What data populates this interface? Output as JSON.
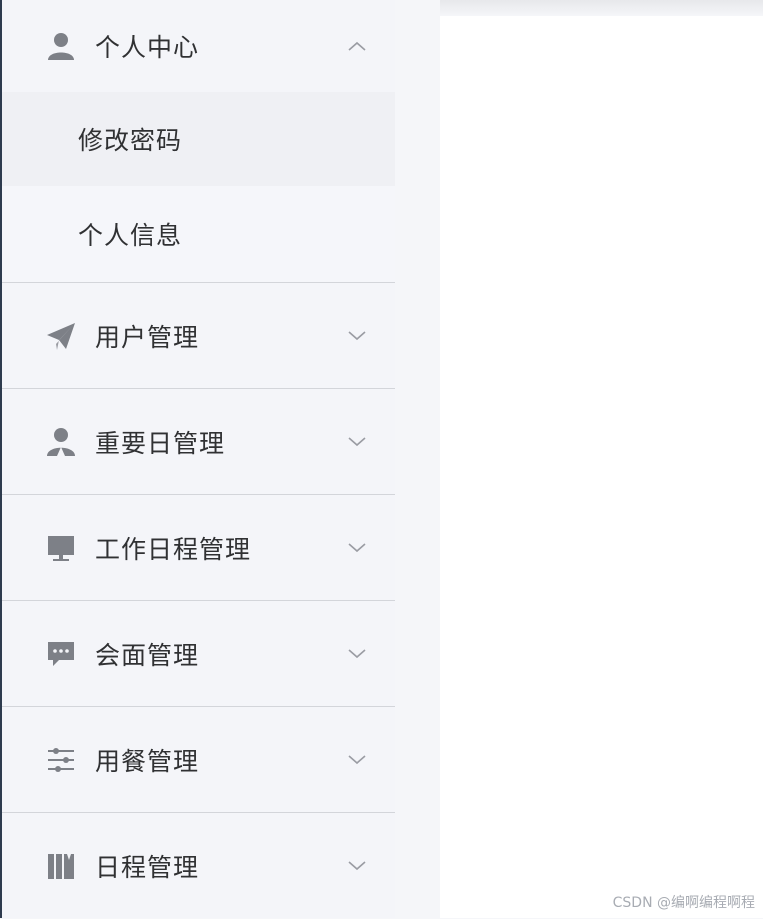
{
  "sidebar": {
    "groups": [
      {
        "label": "个人中心",
        "icon": "user-icon",
        "expanded": true
      },
      {
        "label": "用户管理",
        "icon": "send-icon",
        "expanded": false
      },
      {
        "label": "重要日管理",
        "icon": "user-group-icon",
        "expanded": false
      },
      {
        "label": "工作日程管理",
        "icon": "monitor-icon",
        "expanded": false
      },
      {
        "label": "会面管理",
        "icon": "chat-icon",
        "expanded": false
      },
      {
        "label": "用餐管理",
        "icon": "sliders-icon",
        "expanded": false
      },
      {
        "label": "日程管理",
        "icon": "books-icon",
        "expanded": false
      }
    ],
    "sub_items": [
      {
        "label": "修改密码"
      },
      {
        "label": "个人信息"
      }
    ]
  },
  "watermark": "CSDN @编啊编程啊程",
  "colors": {
    "icon": "#7d8087",
    "text": "#303133",
    "divider": "#d3d5da",
    "sidebar_bg": "#f4f5f9"
  }
}
